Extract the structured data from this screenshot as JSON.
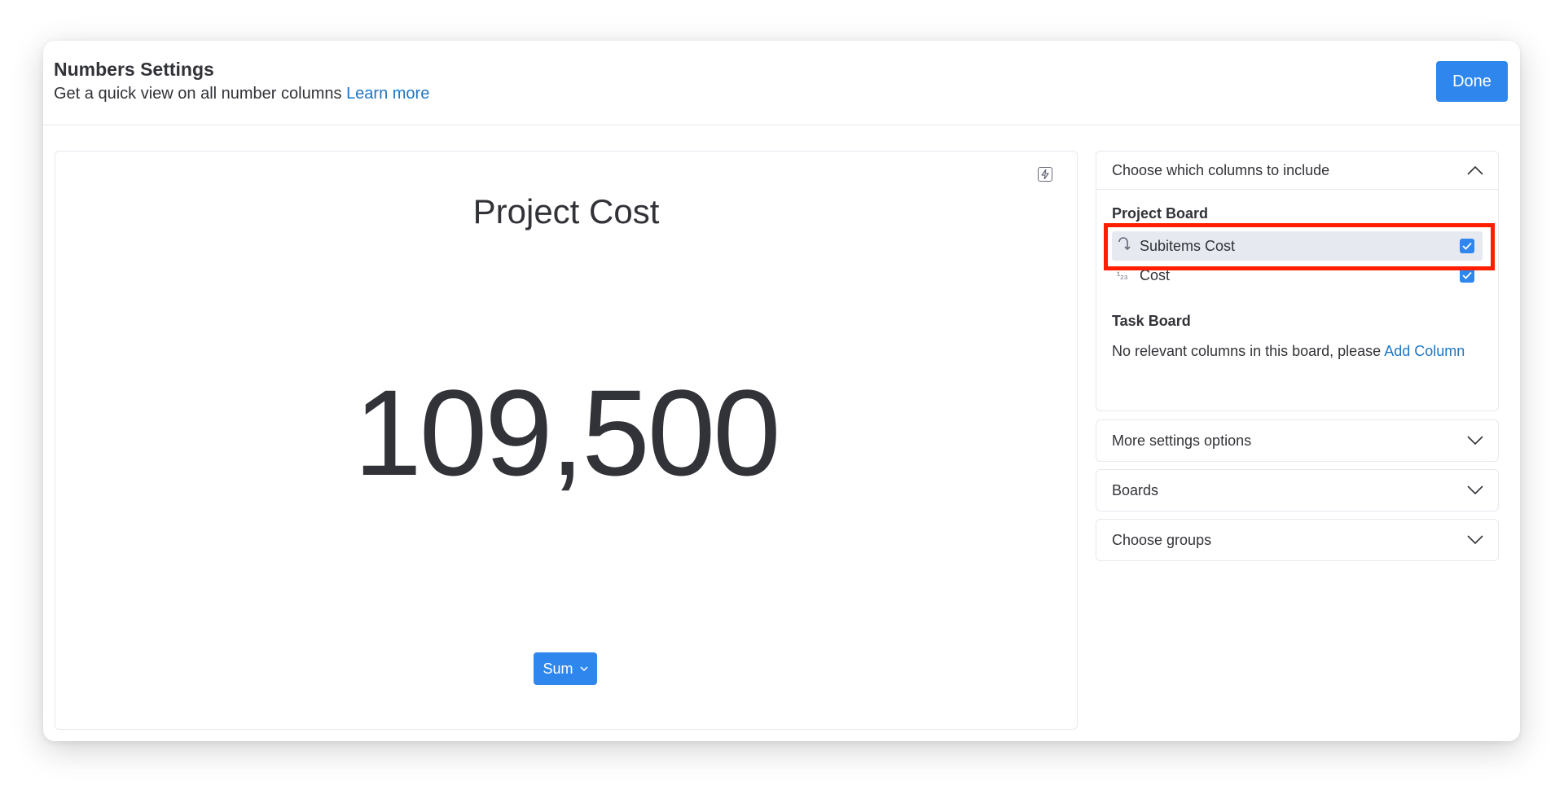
{
  "header": {
    "title": "Numbers Settings",
    "subtitle": "Get a quick view on all number columns",
    "learn_more": "Learn more",
    "done_label": "Done"
  },
  "preview": {
    "title": "Project Cost",
    "value": "109,500",
    "function_label": "Sum"
  },
  "columns_panel": {
    "header": "Choose which columns to include",
    "boards": [
      {
        "name": "Project Board",
        "columns": [
          {
            "label": "Subitems Cost",
            "icon": "subitems-icon",
            "checked": true,
            "highlighted": true
          },
          {
            "label": "Cost",
            "icon": "numbers-icon",
            "checked": true,
            "highlighted": false
          }
        ]
      },
      {
        "name": "Task Board",
        "empty_text": "No relevant columns in this board, please",
        "empty_link": "Add Column"
      }
    ]
  },
  "collapsed_panels": [
    {
      "label": "More settings options"
    },
    {
      "label": "Boards"
    },
    {
      "label": "Choose groups"
    }
  ],
  "colors": {
    "accent": "#2f87ed",
    "link": "#1f76c2",
    "highlight_border": "#ff1f00"
  }
}
